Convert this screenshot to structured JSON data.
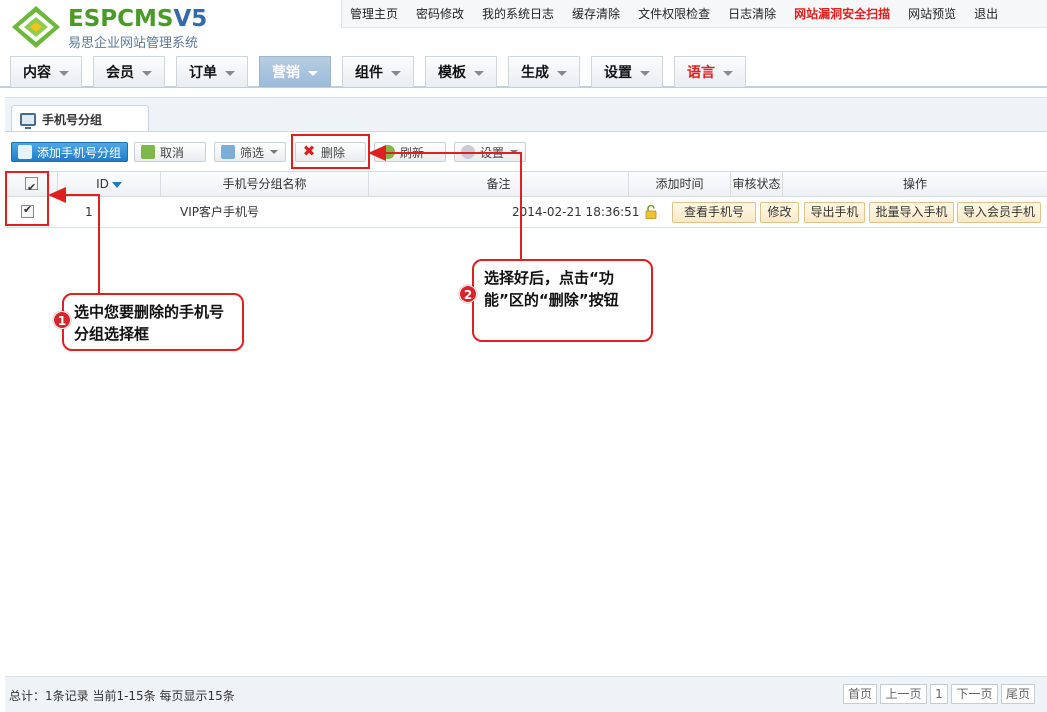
{
  "brand": {
    "logo_primary": "ESPCMS",
    "logo_version": "V5",
    "logo_subtitle": "易思企业网站管理系统"
  },
  "topnav": {
    "items": [
      "管理主页",
      "密码修改",
      "我的系统日志",
      "缓存清除",
      "文件权限检查",
      "日志清除",
      "网站漏洞安全扫描",
      "网站预览",
      "退出"
    ]
  },
  "main_tabs": [
    "内容",
    "会员",
    "订单",
    "营销",
    "组件",
    "模板",
    "生成",
    "设置",
    "语言"
  ],
  "active_tab": "营销",
  "subtab": {
    "label": "手机号分组"
  },
  "toolbar": {
    "add": "添加手机号分组",
    "cancel": "取消",
    "filter": "筛选",
    "delete": "删除",
    "refresh": "刷新",
    "settings": "设置"
  },
  "table": {
    "columns": [
      "ID",
      "手机号分组名称",
      "备注",
      "添加时间",
      "审核状态",
      "操作"
    ],
    "rows": [
      {
        "id": "1",
        "name": "VIP客户手机号",
        "remark": "",
        "add_time": "2014-02-21 18:36:51",
        "actions": [
          "查看手机号",
          "修改",
          "导出手机",
          "批量导入手机",
          "导入会员手机"
        ]
      }
    ]
  },
  "annotations": {
    "step1_num": "1",
    "step1_text": "选中您要删除的手机号分组选择框",
    "step2_num": "2",
    "step2_text": "选择好后，点击“功能”区的“删除”按钮"
  },
  "footer": {
    "summary": "总计：1条记录 当前1-15条 每页显示15条",
    "first": "首页",
    "prev": "上一页",
    "page": "1",
    "next": "下一页",
    "last": "尾页"
  },
  "colors": {
    "accent_red": "#e0201e",
    "tab_active": "#9bbad8",
    "brand_green": "#4a9a25",
    "brand_blue": "#356aa8"
  }
}
